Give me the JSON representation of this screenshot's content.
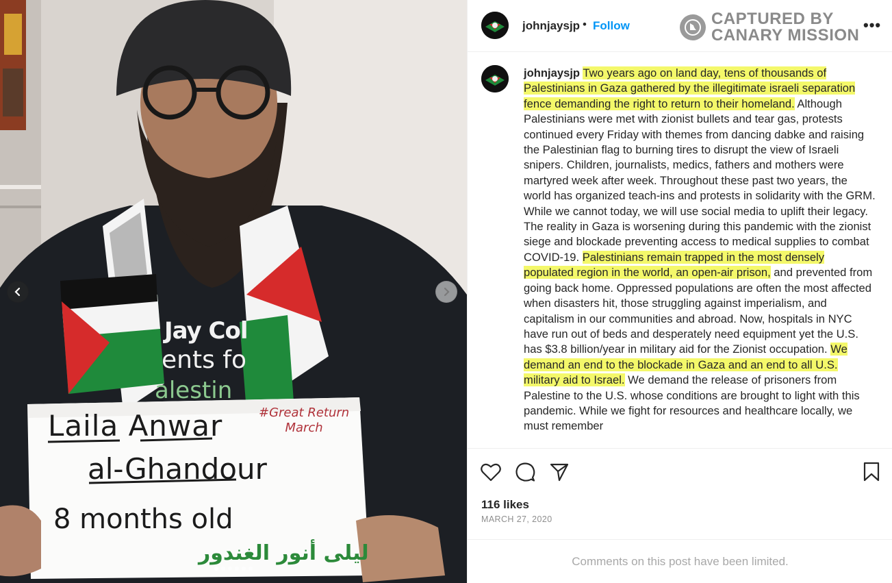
{
  "photo": {
    "sign": {
      "name_line1": "Laila Anwar",
      "name_line2": "al-Ghandour",
      "age": "8 months old",
      "hashtag_line1": "#Great Return",
      "hashtag_line2": "March",
      "arabic": "ليلى أنور الغندور"
    },
    "shirt": {
      "line1": "Jay Col",
      "line2": "ents fo",
      "line3": "alestin"
    },
    "carousel": {
      "prev_icon": "chevron-left-icon",
      "next_icon": "chevron-right-icon",
      "slide_count": 6,
      "active_index": 0
    }
  },
  "header": {
    "username": "johnjaysjp",
    "separator": "•",
    "follow_label": "Follow",
    "watermark_line1": "CAPTURED BY",
    "watermark_line2": "CANARY MISSION",
    "more_label": "•••"
  },
  "caption": {
    "username": "johnjaysjp",
    "segments": [
      {
        "text": "Two years ago on land day, tens of thousands of Palestinians in Gaza gathered by the illegitimate israeli separation fence demanding the right to return to their homeland.",
        "highlight": true
      },
      {
        "text": " Although Palestinians were met with zionist bullets and tear gas, protests continued every Friday with themes from dancing dabke and raising the Palestinian flag to burning tires to disrupt the view of Israeli snipers. Children, journalists, medics, fathers and mothers were martyred week after week. Throughout these past two years, the world has organized teach-ins and protests in solidarity with the GRM. While we cannot today, we will use social media to uplift their legacy.",
        "highlight": false
      },
      {
        "text": "The reality in Gaza is worsening during this pandemic with the zionist siege and blockade preventing access to medical supplies to combat COVID-19. ",
        "highlight": false
      },
      {
        "text": "Palestinians remain trapped in the most densely populated region in the world, an open-air prison,",
        "highlight": true
      },
      {
        "text": " and prevented from going back home. Oppressed populations are often the most affected when disasters hit, those struggling against imperialism, and capitalism in our communities and abroad. Now, hospitals in NYC have run out of beds and desperately need equipment yet the U.S. has $3.8 billion/year in military aid for the Zionist occupation. ",
        "highlight": false
      },
      {
        "text": "We demand an end to the blockade in Gaza and an end to all U.S. military aid to Israel.",
        "highlight": true
      },
      {
        "text": " We demand the release of prisoners from Palestine to the U.S. whose conditions are brought to light with this pandemic. While we fight for resources and healthcare locally, we must remember",
        "highlight": false
      }
    ]
  },
  "actions": {
    "like_icon": "heart-icon",
    "comment_icon": "comment-icon",
    "share_icon": "share-icon",
    "save_icon": "bookmark-icon"
  },
  "likes_text": "116 likes",
  "date_text": "MARCH 27, 2020",
  "comments_limited_text": "Comments on this post have been limited.",
  "colors": {
    "highlight": "#f4f86a",
    "follow": "#0095f6",
    "muted": "#8e8e8e",
    "flag_red": "#d62b2b",
    "flag_green": "#1f8a3b"
  }
}
